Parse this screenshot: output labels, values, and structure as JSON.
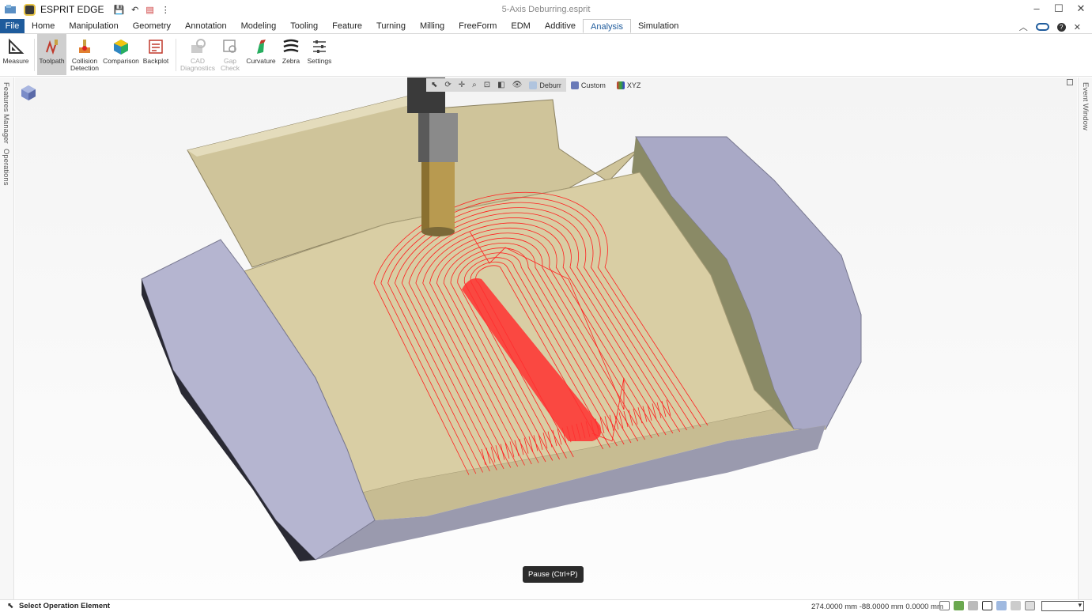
{
  "app": {
    "name": "ESPRIT EDGE",
    "document_title": "5-Axis Deburring.esprit"
  },
  "window_controls": {
    "minimize": "–",
    "maximize": "☐",
    "close": "✕"
  },
  "menu": {
    "items": [
      "File",
      "Home",
      "Manipulation",
      "Geometry",
      "Annotation",
      "Modeling",
      "Tooling",
      "Feature",
      "Turning",
      "Milling",
      "FreeForm",
      "EDM",
      "Additive",
      "Analysis",
      "Simulation"
    ],
    "active": "Analysis"
  },
  "ribbon": {
    "buttons": [
      {
        "label": "Measure",
        "icon": "measure-icon",
        "state": "normal"
      },
      {
        "label": "Toolpath",
        "icon": "toolpath-icon",
        "state": "selected"
      },
      {
        "label": "Collision\nDetection",
        "icon": "collision-detection-icon",
        "state": "normal"
      },
      {
        "label": "Comparison",
        "icon": "comparison-icon",
        "state": "normal"
      },
      {
        "label": "Backplot",
        "icon": "backplot-icon",
        "state": "normal"
      },
      {
        "label": "CAD\nDiagnostics",
        "icon": "cad-diagnostics-icon",
        "state": "disabled"
      },
      {
        "label": "Gap\nCheck",
        "icon": "gap-check-icon",
        "state": "disabled"
      },
      {
        "label": "Curvature",
        "icon": "curvature-icon",
        "state": "normal"
      },
      {
        "label": "Zebra",
        "icon": "zebra-icon",
        "state": "normal"
      },
      {
        "label": "Settings",
        "icon": "settings-icon",
        "state": "normal"
      }
    ]
  },
  "left_panel": {
    "tabs": [
      "Features Manager",
      "Operations"
    ]
  },
  "right_panel": {
    "tabs": [
      "Event Window"
    ]
  },
  "view_toolbar": {
    "items": [
      {
        "label": "Deburr",
        "icon": "layer-icon"
      },
      {
        "label": "Custom",
        "icon": "view-cube-icon"
      },
      {
        "label": "XYZ",
        "icon": "axis-icon"
      }
    ]
  },
  "tooltip": {
    "text": "Pause (Ctrl+P)"
  },
  "status": {
    "text": "Select Operation Element",
    "coordinates": "274.0000 mm  -88.0000 mm  0.0000 mm"
  },
  "colors": {
    "file_menu_bg": "#1e5b9c",
    "part_surface": "#d8cca0",
    "part_side": "#a8a8c4",
    "toolpath": "#ff0000",
    "tool_shank": "#8a8a8a",
    "tool_holder": "#3a3a3a",
    "tool_cutter": "#b89a50"
  }
}
